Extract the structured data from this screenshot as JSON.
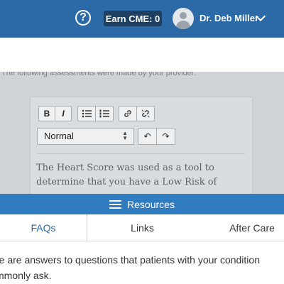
{
  "header": {
    "help_icon": "question-circle-icon",
    "help_glyph": "?",
    "cme_label": "Earn CME: 0",
    "user_name": "Dr. Deb Miller"
  },
  "content": {
    "intro": "The following assessments were made by your provider:",
    "toolbar": {
      "bold": "B",
      "italic": "I",
      "format_value": "Normal",
      "undo": "↶",
      "redo": "↷"
    },
    "editor_text": "The Heart Score was used as a tool to determine that you have a Low Risk of"
  },
  "resources": {
    "title": "Resources",
    "tabs": [
      {
        "label": "FAQs"
      },
      {
        "label": "Links"
      },
      {
        "label": "After Care"
      }
    ],
    "body": "re are answers to questions that patients with your condition mmonly ask."
  }
}
